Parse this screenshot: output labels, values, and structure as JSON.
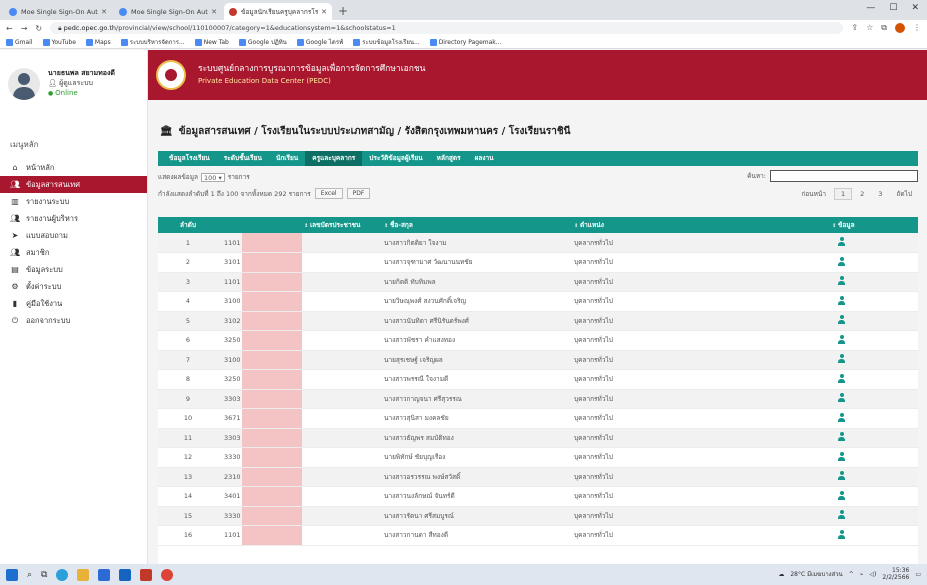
{
  "browser": {
    "tabs": [
      {
        "label": "Moe Single Sign-On Authenticati..."
      },
      {
        "label": "Moe Single Sign-On Authenticati..."
      },
      {
        "label": "ข้อมูลนักเรียนครูบุคลากรโรงเรียน..."
      }
    ],
    "url_host": "pedc.opec.go.th",
    "url_path": "/provincial/view/school/110100007/category=1&educationsystem=1&schoolstatus=1",
    "bookmarks": [
      "Gmail",
      "YouTube",
      "Maps",
      "ระบบบริหารจัดการ...",
      "New Tab",
      "Google ปฏิทิน",
      "Google ไดรฟ์",
      "ระบบข้อมูลโรงเรียน...",
      "Directory Pagemak..."
    ]
  },
  "sidebar": {
    "user_name": "นายธนพล สยามทองดี",
    "user_role": "ผู้ดูแลระบบ",
    "user_status": "Online",
    "menu_title": "เมนูหลัก",
    "items": [
      {
        "label": "หน้าหลัก",
        "icon": "home-icon"
      },
      {
        "label": "ข้อมูลสารสนเทศ",
        "icon": "users-icon",
        "active": true
      },
      {
        "label": "รายงานระบบ",
        "icon": "chart-icon"
      },
      {
        "label": "รายงานผู้บริหาร",
        "icon": "people-icon"
      },
      {
        "label": "แบบสอบถาม",
        "icon": "send-icon"
      },
      {
        "label": "สมาชิก",
        "icon": "members-icon"
      },
      {
        "label": "ข้อมูลระบบ",
        "icon": "doc-icon"
      },
      {
        "label": "ตั้งค่าระบบ",
        "icon": "gear-icon"
      },
      {
        "label": "คู่มือใช้งาน",
        "icon": "book-icon"
      },
      {
        "label": "ออกจากระบบ",
        "icon": "logout-icon"
      }
    ]
  },
  "header": {
    "title": "ระบบศูนย์กลางการบูรณาการข้อมูลเพื่อการจัดการศึกษาเอกชน",
    "subtitle": "Private Education Data Center (PEDC)"
  },
  "breadcrumb": "ข้อมูลสารสนเทศ / โรงเรียนในระบบประเภทสามัญ / รังสิตกรุงเทพมหานคร / โรงเรียนราชินี",
  "tabs": [
    "ข้อมูลโรงเรียน",
    "ระดับชั้นเรียน",
    "นักเรียน",
    "ครูและบุคลากร",
    "ประวัติข้อมูลผู้เรียน",
    "หลักสูตร",
    "ผลงาน"
  ],
  "active_tab_index": 3,
  "controls": {
    "show_label": "แสดงผลข้อมูล",
    "page_size": "100",
    "entries_label": "รายการ",
    "info": "กำลังแสดงลำดับที่ 1 ถึง 100 จากทั้งหมด 292 รายการ",
    "excel_label": "Excel",
    "pdf_label": "PDF",
    "search_label": "ค้นหา:",
    "search_value": "",
    "pagination": {
      "prev": "ก่อนหน้า",
      "pages": [
        "1",
        "2",
        "3"
      ],
      "current": "1",
      "next": "ถัดไป"
    }
  },
  "table": {
    "columns": [
      "ลำดับ",
      "เลขบัตรประชาชน",
      "ชื่อ-สกุล",
      "ตำแหน่ง",
      "ข้อมูล"
    ],
    "rows": [
      {
        "no": "1",
        "id": "1101",
        "name": "นางสาวกิตติยา ใจงาม",
        "position": "บุคลากรทั่วไป"
      },
      {
        "no": "2",
        "id": "3101",
        "name": "นางสาวจุฑามาศ วัฒนานนทชัย",
        "position": "บุคลากรทั่วไป"
      },
      {
        "no": "3",
        "id": "1101",
        "name": "นายกิตติ ทับทิมพล",
        "position": "บุคลากรทั่วไป"
      },
      {
        "no": "4",
        "id": "3100",
        "name": "นายวิษณุพงศ์ สงวนศักดิ์เจริญ",
        "position": "บุคลากรทั่วไป"
      },
      {
        "no": "5",
        "id": "3102",
        "name": "นางสาวนันทิดา ศรีนิรันดร์พงศ์",
        "position": "บุคลากรทั่วไป"
      },
      {
        "no": "6",
        "id": "3250",
        "name": "นางสาวพัชรา คำแสงทอง",
        "position": "บุคลากรทั่วไป"
      },
      {
        "no": "7",
        "id": "3100",
        "name": "นายสุรเชษฐ์ เจริญผล",
        "position": "บุคลากรทั่วไป"
      },
      {
        "no": "8",
        "id": "3250",
        "name": "นางสาวพรรณี ใจงามดี",
        "position": "บุคลากรทั่วไป"
      },
      {
        "no": "9",
        "id": "3303",
        "name": "นางสาวกาญจนา ศรีสุวรรณ",
        "position": "บุคลากรทั่วไป"
      },
      {
        "no": "10",
        "id": "3671",
        "name": "นางสาวสุนิสา มงคลชัย",
        "position": "บุคลากรทั่วไป"
      },
      {
        "no": "11",
        "id": "3303",
        "name": "นางสาวธัญพร สมบัติทอง",
        "position": "บุคลากรทั่วไป"
      },
      {
        "no": "12",
        "id": "3330",
        "name": "นายพิทักษ์ ชัยบุญเรือง",
        "position": "บุคลากรทั่วไป"
      },
      {
        "no": "13",
        "id": "2310",
        "name": "นางสาวอรวรรณ พงษ์สวัสดิ์",
        "position": "บุคลากรทั่วไป"
      },
      {
        "no": "14",
        "id": "3401",
        "name": "นางสาวนงลักษณ์ จันทร์ดี",
        "position": "บุคลากรทั่วไป"
      },
      {
        "no": "15",
        "id": "3330",
        "name": "นางสาวรัตนา ศรีสมบูรณ์",
        "position": "บุคลากรทั่วไป"
      },
      {
        "no": "16",
        "id": "1101",
        "name": "นางสาวกานดา สีทองดี",
        "position": "บุคลากรทั่วไป"
      }
    ]
  },
  "taskbar": {
    "weather": "28°C มีเมฆบางส่วน",
    "time": "15:36",
    "date": "2/2/2566"
  }
}
